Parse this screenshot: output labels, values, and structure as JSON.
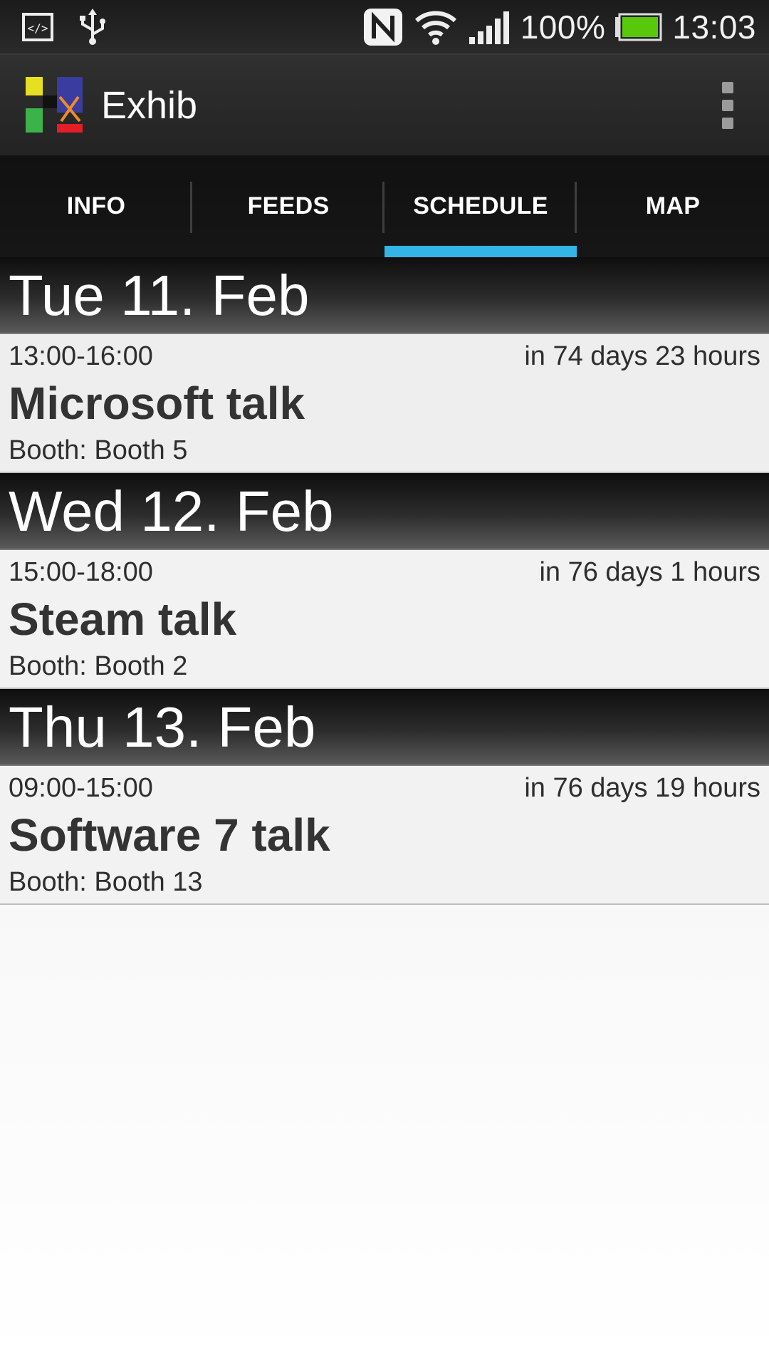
{
  "status_bar": {
    "battery": "100%",
    "time": "13:03",
    "icons": [
      "code-icon",
      "usb-icon",
      "nfc-icon",
      "wifi-icon",
      "signal-icon",
      "battery-icon"
    ],
    "battery_color": "#5ac80a"
  },
  "action_bar": {
    "title": "Exhib",
    "logo_colors": [
      "#e7e021",
      "#3b3ca0",
      "#3cb34a",
      "#e41e26",
      "#f08b2a"
    ]
  },
  "tabs": [
    {
      "label": "INFO",
      "active": false
    },
    {
      "label": "FEEDS",
      "active": false
    },
    {
      "label": "SCHEDULE",
      "active": true
    },
    {
      "label": "MAP",
      "active": false
    }
  ],
  "accent_color": "#33b5e5",
  "schedule": [
    {
      "day": "Tue 11. Feb",
      "events": [
        {
          "time": "13:00-16:00",
          "countdown": "in 74 days 23 hours",
          "title": "Microsoft talk",
          "booth": "Booth: Booth 5"
        }
      ]
    },
    {
      "day": "Wed 12. Feb",
      "events": [
        {
          "time": "15:00-18:00",
          "countdown": "in 76 days 1 hours",
          "title": "Steam talk",
          "booth": "Booth: Booth 2"
        }
      ]
    },
    {
      "day": "Thu 13. Feb",
      "events": [
        {
          "time": "09:00-15:00",
          "countdown": "in 76 days 19 hours",
          "title": "Software 7 talk",
          "booth": "Booth: Booth 13"
        }
      ]
    }
  ]
}
